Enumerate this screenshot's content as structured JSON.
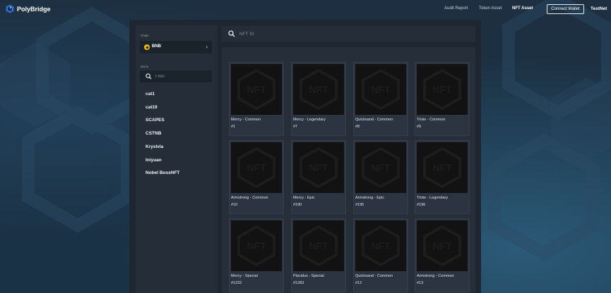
{
  "header": {
    "brand": "PolyBridge",
    "nav": [
      {
        "label": "Audit Report",
        "active": false
      },
      {
        "label": "Token Asset",
        "active": false
      },
      {
        "label": "NFT Asset",
        "active": true
      }
    ],
    "connect_label": "Connect Wallet",
    "network": "TestNet"
  },
  "sidebar": {
    "chain_label": "Chain",
    "chain_value": "BNB",
    "items_label": "Items",
    "filter_placeholder": "Filter",
    "items": [
      "cat1",
      "cat19",
      "SCAPES",
      "CSTNB",
      "Kryslvia",
      "lniyuan",
      "Nobel BossNFT"
    ]
  },
  "search": {
    "placeholder": "NFT ID"
  },
  "cards": [
    {
      "name": "Mercy - Common",
      "id": "#1"
    },
    {
      "name": "Mercy - Legendary",
      "id": "#7"
    },
    {
      "name": "Quicksand - Common",
      "id": "#8"
    },
    {
      "name": "Trixie - Common",
      "id": "#9"
    },
    {
      "name": "Armstrong - Common",
      "id": "#10"
    },
    {
      "name": "Mercy - Epic",
      "id": "#190"
    },
    {
      "name": "Armstrong - Epic",
      "id": "#195"
    },
    {
      "name": "Trixie - Legendary",
      "id": "#196"
    },
    {
      "name": "Mercy - Special",
      "id": "#1232"
    },
    {
      "name": "Placidus - Special",
      "id": "#1283"
    },
    {
      "name": "Quicksand - Common",
      "id": "#12"
    },
    {
      "name": "Armstrong - Common",
      "id": "#13"
    }
  ],
  "nft_placeholder_text": "NFT",
  "colors": {
    "accent_bnb": "#f0b90b",
    "background": "#1b2e3e",
    "panel": "#1e2631"
  }
}
